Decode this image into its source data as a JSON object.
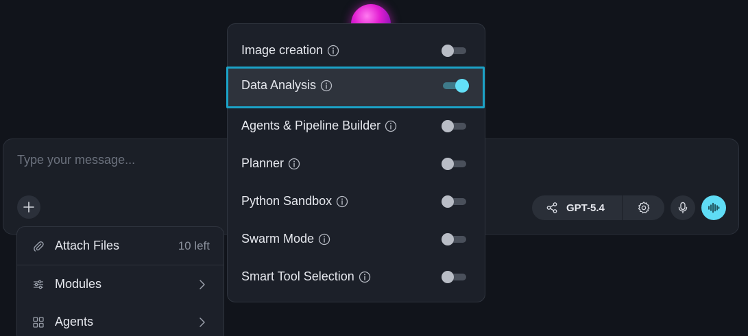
{
  "composer": {
    "placeholder": "Type your message...",
    "model": {
      "label": "GPT-5.4",
      "icon": "share-nodes-icon"
    },
    "buttons": [
      "plus-icon",
      "gear-icon",
      "microphone-icon",
      "voice-waveform-icon"
    ],
    "accent_color": "#5fdcf5"
  },
  "attach_menu": {
    "items": [
      {
        "label": "Attach Files",
        "icon": "paperclip-icon",
        "count": "10 left"
      },
      {
        "label": "Modules",
        "icon": "sliders-icon",
        "submenu": true
      },
      {
        "label": "Agents",
        "icon": "grid-icon",
        "submenu": true
      }
    ]
  },
  "modules_panel": {
    "items": [
      {
        "label": "Image creation",
        "enabled": false
      },
      {
        "label": "Data Analysis",
        "enabled": true,
        "highlighted": true
      },
      {
        "label": "Agents & Pipeline Builder",
        "enabled": false
      },
      {
        "label": "Planner",
        "enabled": false
      },
      {
        "label": "Python Sandbox",
        "enabled": false
      },
      {
        "label": "Swarm Mode",
        "enabled": false
      },
      {
        "label": "Smart Tool Selection",
        "enabled": false
      }
    ],
    "highlight_color": "#1ba3c8"
  }
}
